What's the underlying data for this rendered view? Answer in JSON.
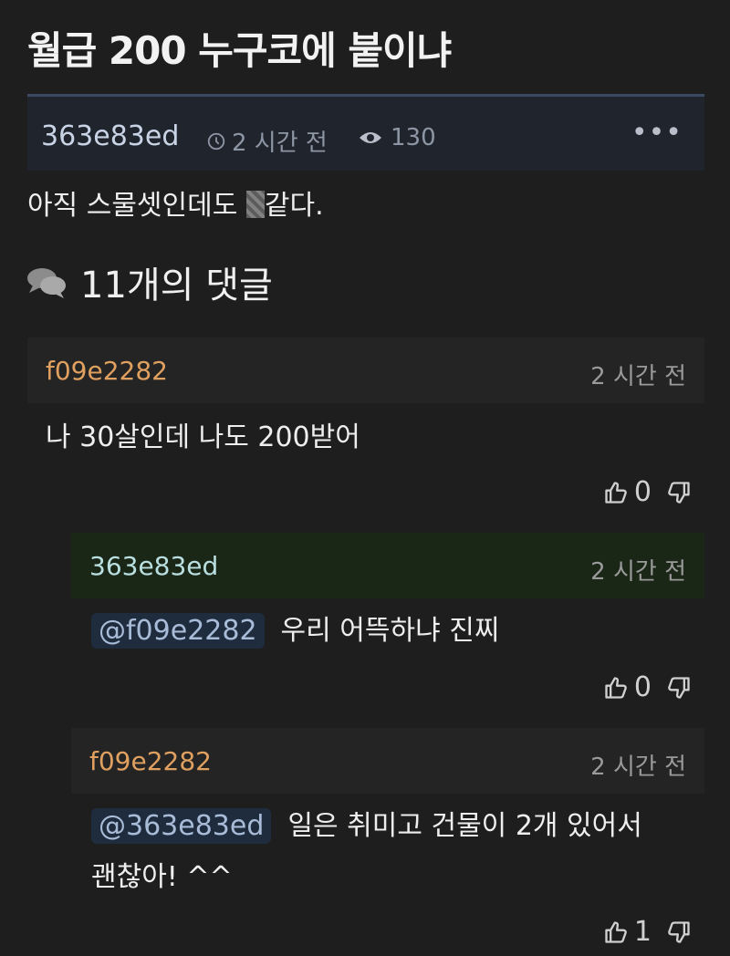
{
  "post": {
    "title": "월급 200 누구코에 붙이냐",
    "author": "363e83ed",
    "time": "2 시간 전",
    "views": "130",
    "more": "•••",
    "body_before": "아직 스물셋인데도 ",
    "body_after": "같다."
  },
  "comments_header": "11개의 댓글",
  "comments": [
    {
      "author": "f09e2282",
      "time": "2 시간 전",
      "mention": "",
      "text": "나 30살인데 나도 200받어",
      "text2": "",
      "likes": "0"
    },
    {
      "author": "363e83ed",
      "time": "2 시간 전",
      "mention": "@f09e2282",
      "text": "우리 어뜩하냐 진찌",
      "text2": "",
      "likes": "0"
    },
    {
      "author": "f09e2282",
      "time": "2 시간 전",
      "mention": "@363e83ed",
      "text": "일은 취미고 건물이 2개 있어서",
      "text2": "괜찮아! ^^",
      "likes": "1"
    }
  ],
  "colors": {
    "background": "#1e1e1e",
    "author_orange": "#e0a060",
    "author_teal": "#b9dfe0",
    "reply_highlight": "#1a2616",
    "mention_bg": "#1f2c3e"
  },
  "icons": [
    "clock-icon",
    "eye-icon",
    "more-icon",
    "comments-icon",
    "thumbs-up-icon",
    "thumbs-down-icon"
  ]
}
